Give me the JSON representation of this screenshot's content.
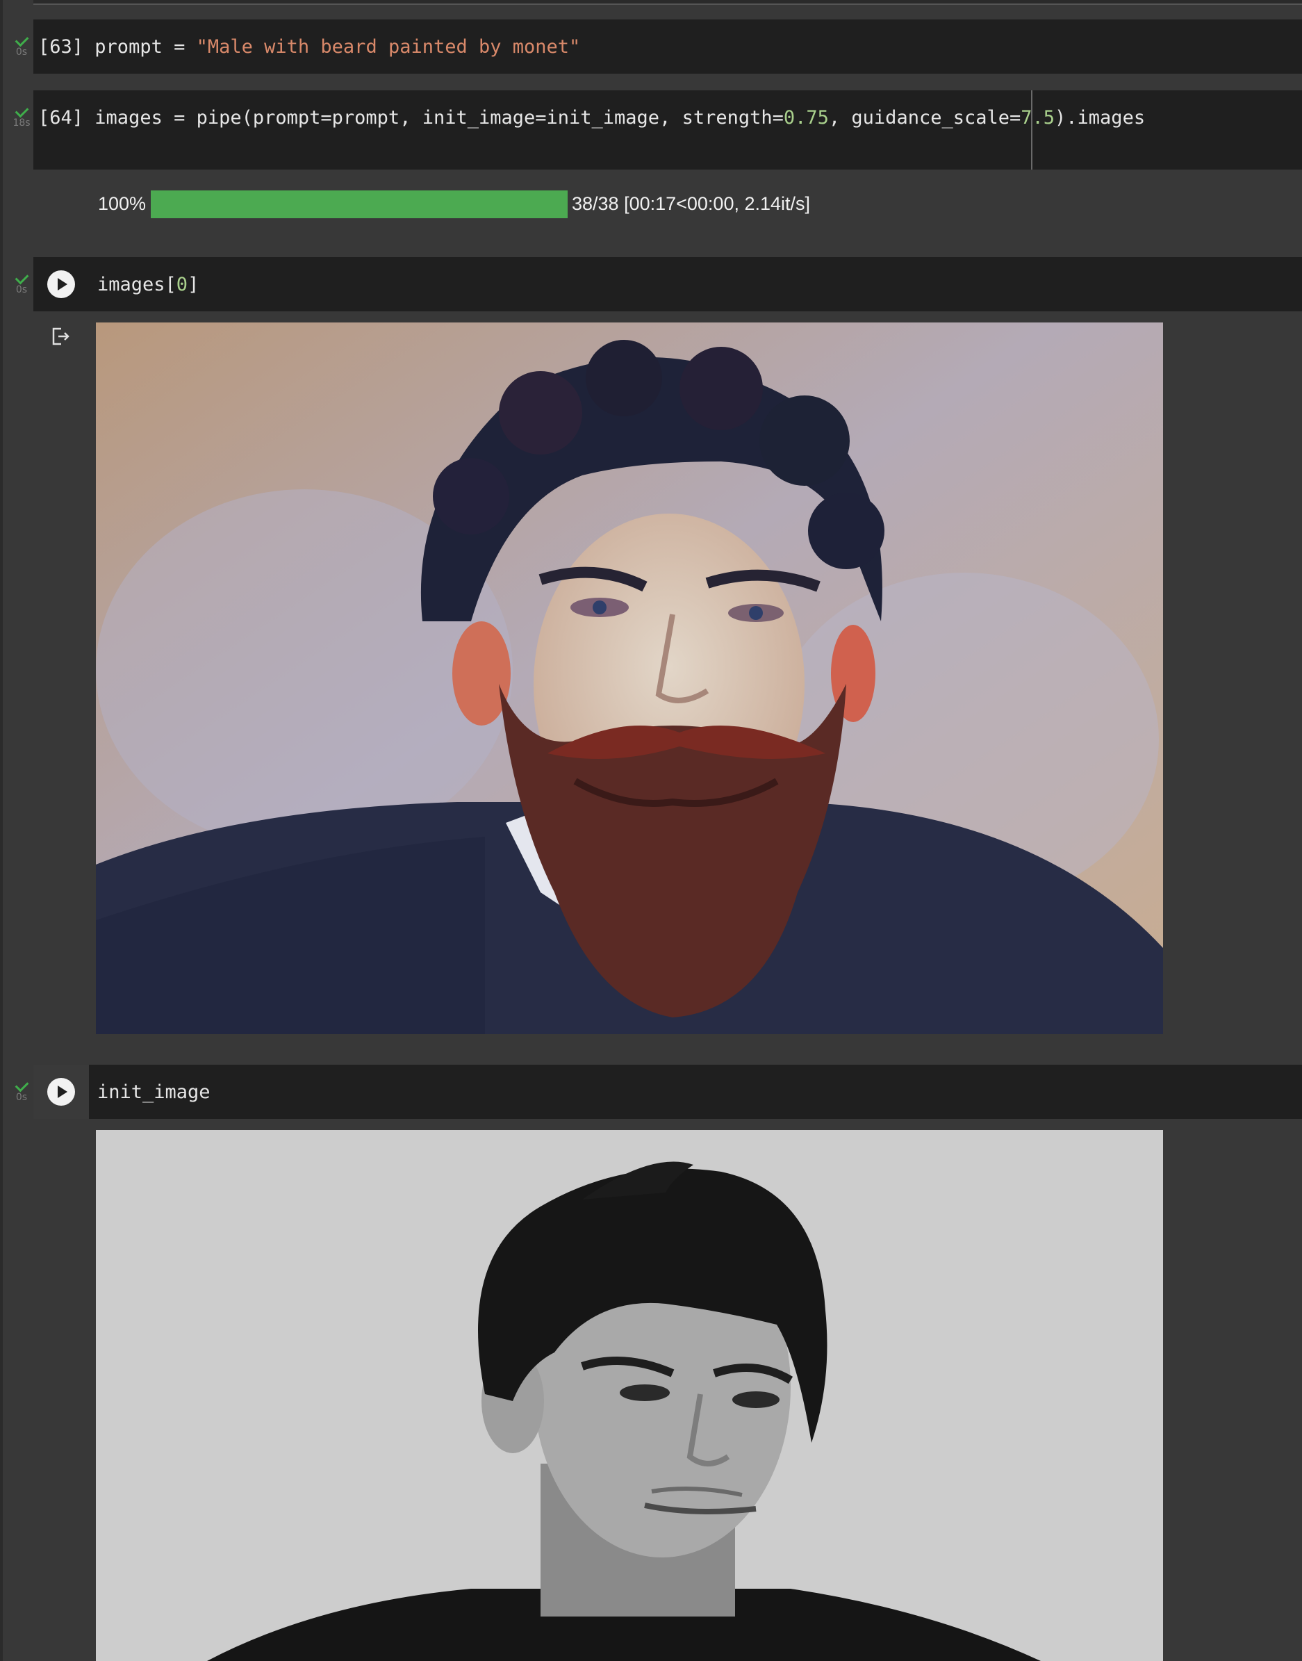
{
  "cells": [
    {
      "id": "cell-63",
      "exec_count": "[63]",
      "exec_time": "0s",
      "tokens": [
        {
          "text": "prompt = ",
          "cls": ""
        },
        {
          "text": "\"Male with beard painted by monet\"",
          "cls": "str"
        }
      ]
    },
    {
      "id": "cell-64",
      "exec_count": "[64]",
      "exec_time": "18s",
      "tokens": [
        {
          "text": "images = pipe(prompt=prompt, init_image=init_image, strength=",
          "cls": ""
        },
        {
          "text": "0.75",
          "cls": "num"
        },
        {
          "text": ", guidance_scale=",
          "cls": ""
        },
        {
          "text": "7.5",
          "cls": "num"
        },
        {
          "text": ").images",
          "cls": ""
        }
      ],
      "progress": {
        "percent_label": "100%",
        "fraction": 1.0,
        "detail": "38/38 [00:17<00:00, 2.14it/s]"
      }
    },
    {
      "id": "cell-images0",
      "exec_time": "0s",
      "tokens": [
        {
          "text": "images[",
          "cls": ""
        },
        {
          "text": "0",
          "cls": "num"
        },
        {
          "text": "]",
          "cls": ""
        }
      ],
      "output_image": "Monet-style painted portrait of a bearded man with curly dark hair and dark sweater"
    },
    {
      "id": "cell-init-image",
      "exec_time": "0s",
      "tokens": [
        {
          "text": "init_image",
          "cls": ""
        }
      ],
      "output_image": "Black and white photo of a young man with short dark hair looking to the side"
    }
  ],
  "colors": {
    "background": "#383838",
    "cell_bg": "#1f1f1f",
    "check_green": "#3fae4b",
    "progress_green": "#4caa51",
    "string": "#d9896a",
    "number": "#a9d08c"
  },
  "icons": {
    "status": "check-icon",
    "run": "play-icon",
    "output": "output-redirect-icon"
  }
}
